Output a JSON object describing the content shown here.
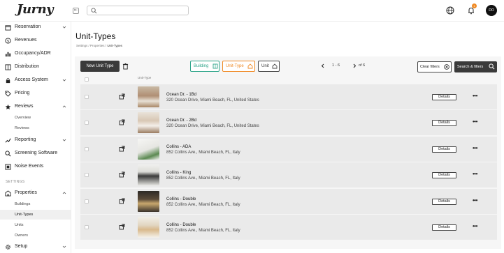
{
  "header": {
    "logo": "Jurny",
    "search_placeholder": "",
    "notification_count": "1",
    "avatar_initials": "DO"
  },
  "sidebar": {
    "items": [
      {
        "label": "Reservation",
        "icon": "calendar-icon",
        "chevron": "down"
      },
      {
        "label": "Revenues",
        "icon": "dollar-icon",
        "chevron": ""
      },
      {
        "label": "Occupancy/ADR",
        "icon": "chart-icon",
        "chevron": ""
      },
      {
        "label": "Distribution",
        "icon": "distribution-icon",
        "chevron": ""
      },
      {
        "label": "Access System",
        "icon": "lock-icon",
        "chevron": "down"
      },
      {
        "label": "Pricing",
        "icon": "tag-icon",
        "chevron": ""
      },
      {
        "label": "Reviews",
        "icon": "star-icon",
        "chevron": "up"
      },
      {
        "label": "Reporting",
        "icon": "report-icon",
        "chevron": "down"
      },
      {
        "label": "Screening Software",
        "icon": "search-icon",
        "chevron": ""
      },
      {
        "label": "Noise Events",
        "icon": "noise-icon",
        "chevron": ""
      },
      {
        "label": "Properties",
        "icon": "building-icon",
        "chevron": "up"
      },
      {
        "label": "Setup",
        "icon": "gear-icon",
        "chevron": "down"
      }
    ],
    "reviews_sub": [
      "Overview",
      "Reviews"
    ],
    "section_settings": "SETTINGS",
    "properties_sub": [
      "Buildings",
      "Unit-Types",
      "Units",
      "Owners"
    ]
  },
  "page": {
    "title": "Unit-Types",
    "breadcrumb": [
      "Settings",
      "Properties",
      "Unit-Types"
    ]
  },
  "toolbar": {
    "new_label": "New Unit Type",
    "filters": [
      {
        "label": "Building",
        "color": "#2ea58a"
      },
      {
        "label": "Unit-Type",
        "color": "#f08a24"
      },
      {
        "label": "Unit",
        "color": "#444444"
      }
    ],
    "pagination": {
      "range": "1 - 6",
      "of": "of 6"
    },
    "clear_label": "Clear filters",
    "search_label": "Search & filters"
  },
  "table": {
    "column_header": "Unit-Type",
    "details_label": "Details",
    "rows": [
      {
        "name": "Ocean Dr. - 1Bd",
        "address": "320 Ocean Drive, Miami Beach, FL, United States"
      },
      {
        "name": "Ocean Dr. - 2Bd",
        "address": "320 Ocean Drive, Miami Beach, FL, United States"
      },
      {
        "name": "Collins - ADA",
        "address": "852 Collins Ave., Miami Beach, FL, Italy"
      },
      {
        "name": "Collins - King",
        "address": "852 Collins Ave., Miami Beach, FL, Italy"
      },
      {
        "name": "Collins - Double",
        "address": "852 Collins Ave., Miami Beach, FL, Italy"
      },
      {
        "name": "Collins - Double",
        "address": "852 Collins Ave., Miami Beach, FL, Italy"
      }
    ]
  }
}
